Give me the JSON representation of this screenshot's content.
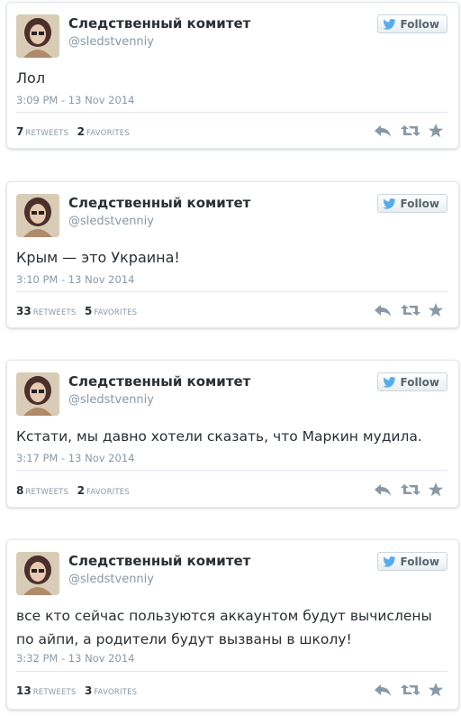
{
  "follow_label": "Follow",
  "icons": {
    "bird": "twitter-bird-icon",
    "reply": "reply-icon",
    "retweet": "retweet-icon",
    "favorite": "star-icon"
  },
  "colors": {
    "follow_text": "#55656f",
    "bird": "#55acee",
    "action_icons": "#8899a6",
    "meta_text": "#8899a6",
    "body_text": "#292f33"
  },
  "tweets": [
    {
      "name": "Следственный комитет",
      "handle": "@sledstvenniy",
      "text": "Лол",
      "time": "3:09 PM - 13 Nov 2014",
      "retweets": "7",
      "retweets_label": "RETWEETS",
      "favorites": "2",
      "favorites_label": "FAVORITES"
    },
    {
      "name": "Следственный комитет",
      "handle": "@sledstvenniy",
      "text": "Крым — это Украина!",
      "time": "3:10 PM - 13 Nov 2014",
      "retweets": "33",
      "retweets_label": "RETWEETS",
      "favorites": "5",
      "favorites_label": "FAVORITES"
    },
    {
      "name": "Следственный комитет",
      "handle": "@sledstvenniy",
      "text": "Кстати, мы давно хотели сказать, что Маркин мудила.",
      "time": "3:17 PM - 13 Nov 2014",
      "retweets": "8",
      "retweets_label": "RETWEETS",
      "favorites": "2",
      "favorites_label": "FAVORITES"
    },
    {
      "name": "Следственный комитет",
      "handle": "@sledstvenniy",
      "text": "все кто сейчас пользуются аккаунтом будут вычислены по айпи, а родители будут вызваны в школу!",
      "time": "3:32 PM - 13 Nov 2014",
      "retweets": "13",
      "retweets_label": "RETWEETS",
      "favorites": "3",
      "favorites_label": "FAVORITES"
    }
  ]
}
